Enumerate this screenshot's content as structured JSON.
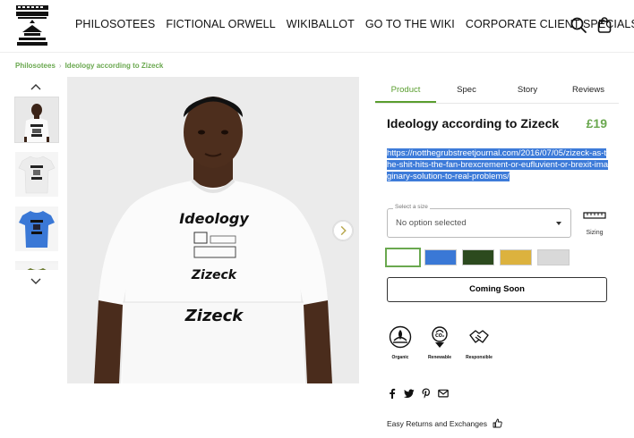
{
  "header": {
    "nav": [
      "PHILOSOTEES",
      "FICTIONAL ORWELL",
      "WIKIBALLOT",
      "GO TO THE WIKI",
      "CORPORATE CLIENT SPECIALS"
    ]
  },
  "breadcrumb": {
    "home": "Philosotees",
    "current": "Ideology according to Zizeck"
  },
  "product": {
    "tabs": [
      "Product",
      "Spec",
      "Story",
      "Reviews"
    ],
    "title": "Ideology according to Zizeck",
    "price": "£19",
    "description": "https://notthegrubstreetjournal.com/2016/07/05/zizeck-as-the-shit-hits-the-fan-brexcrement-or-eufluvient-or-brexit-imaginary-solution-to-real-problems/",
    "size_legend": "Select a size",
    "size_value": "No option selected",
    "sizing_label": "Sizing",
    "swatch_colors": [
      "#ffffff",
      "#3a78d6",
      "#2c4a1e",
      "#dcb23e",
      "#d9d9d9"
    ],
    "coming_soon": "Coming Soon",
    "badges": [
      "Organic",
      "Renewable",
      "Responsible"
    ],
    "returns": "Easy Returns and Exchanges"
  },
  "shirt_print": {
    "line1": "Ideology",
    "line2": "Zizeck",
    "line3": "Zizeck"
  },
  "colors": {
    "accent": "#6aa84f",
    "highlight": "#3d7bd9"
  }
}
